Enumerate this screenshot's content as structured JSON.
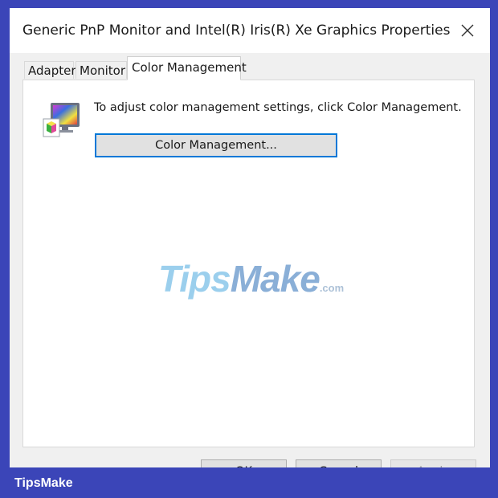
{
  "window": {
    "title": "Generic PnP Monitor and Intel(R) Iris(R) Xe Graphics Properties"
  },
  "tabs": [
    {
      "label": "Adapter",
      "active": false
    },
    {
      "label": "Monitor",
      "active": false
    },
    {
      "label": "Color Management",
      "active": true
    }
  ],
  "panel": {
    "icon": "color-monitor-icon",
    "instruction": "To adjust color management settings, click Color Management.",
    "button_label": "Color Management..."
  },
  "watermark": {
    "tips": "Tips",
    "make": "Make",
    "com": ".com"
  },
  "buttons": {
    "ok": "OK",
    "cancel": "Cancel",
    "apply": "Apply"
  },
  "footer": {
    "brand": "TipsMake"
  },
  "colors": {
    "background": "#3b45b8",
    "focus_border": "#0078d7",
    "dialog_bg": "#f0f0f0"
  }
}
